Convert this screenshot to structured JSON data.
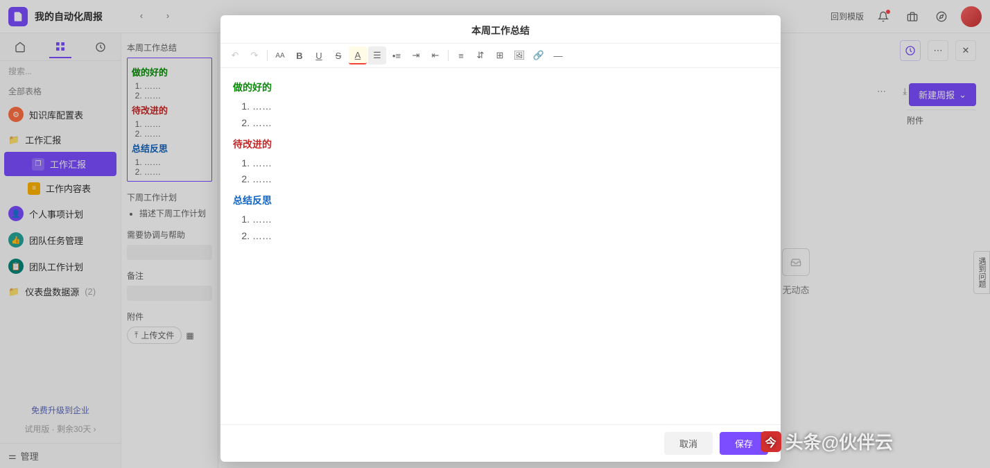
{
  "header": {
    "doc_title": "我的自动化周报",
    "template_btn": "回到模版"
  },
  "sidebar": {
    "search_placeholder": "搜索...",
    "section_title": "全部表格",
    "items": [
      {
        "label": "知识库配置表",
        "icon": "gear",
        "color": "ico-orange"
      },
      {
        "label": "工作汇报",
        "icon": "folder",
        "indent": 0
      },
      {
        "label": "工作汇报",
        "icon": "copy",
        "indent": 2,
        "active": true
      },
      {
        "label": "工作内容表",
        "icon": "list",
        "color": "ico-yellow",
        "indent": 2
      },
      {
        "label": "个人事项计划",
        "icon": "user",
        "color": "ico-purple"
      },
      {
        "label": "团队任务管理",
        "icon": "thumb",
        "color": "ico-green"
      },
      {
        "label": "团队工作计划",
        "icon": "calendar",
        "color": "ico-teal"
      },
      {
        "label": "仪表盘数据源",
        "icon": "folder",
        "count": "(2)"
      }
    ],
    "upgrade": "免费升级到企业",
    "trial": "试用版 · 剩余30天",
    "manage": "管理"
  },
  "preview": {
    "title1": "本周工作总结",
    "good": "做的好的",
    "bad": "待改进的",
    "reflect": "总结反思",
    "item": "……",
    "title2": "下周工作计划",
    "next_item": "描述下周工作计划",
    "title3": "需要协调与帮助",
    "title4": "备注",
    "title5": "附件",
    "upload": "上传文件"
  },
  "right": {
    "new_btn": "新建周报",
    "col_attach": "附件",
    "no_activity": "无动态"
  },
  "modal": {
    "title": "本周工作总结",
    "good": "做的好的",
    "bad": "待改进的",
    "reflect": "总结反思",
    "item": "……",
    "cancel": "取消",
    "save": "保存"
  },
  "watermark": "头条@伙伴云",
  "feedback": "遇到问题"
}
